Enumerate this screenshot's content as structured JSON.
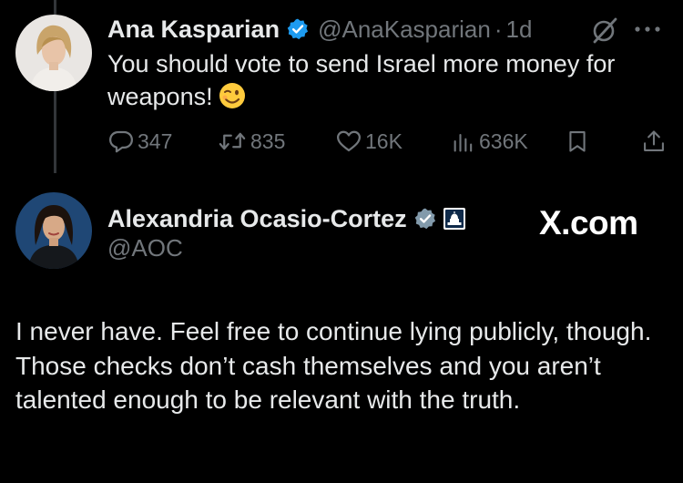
{
  "tweet_parent": {
    "author_name": "Ana Kasparian",
    "handle": "@AnaKasparian",
    "separator": "·",
    "time": "1d",
    "text": "You should vote to send Israel more money for weapons!",
    "emoji": "winking-face",
    "stats": {
      "replies": "347",
      "retweets": "835",
      "likes": "16K",
      "views": "636K"
    }
  },
  "tweet_reply": {
    "author_name": "Alexandria Ocasio-Cortez",
    "handle": "@AOC",
    "text": "I never have. Feel free to continue lying publicly, though. Those checks don’t cash themselves and you aren’t talented enough to be relevant with the truth."
  },
  "watermark": "X.com",
  "icons": {
    "verified": "verified-badge-icon",
    "gov_label": "capitol-building-icon",
    "reply": "reply-icon",
    "retweet": "retweet-icon",
    "like": "heart-icon",
    "views": "views-chart-icon",
    "bookmark": "bookmark-icon",
    "share": "share-icon",
    "grok": "grok-icon",
    "more": "more-options-icon"
  },
  "colors": {
    "background": "#000000",
    "text": "#e7e9ea",
    "muted": "#71767b",
    "verified_blue": "#1d9bf0",
    "verified_gray": "#829aab"
  }
}
